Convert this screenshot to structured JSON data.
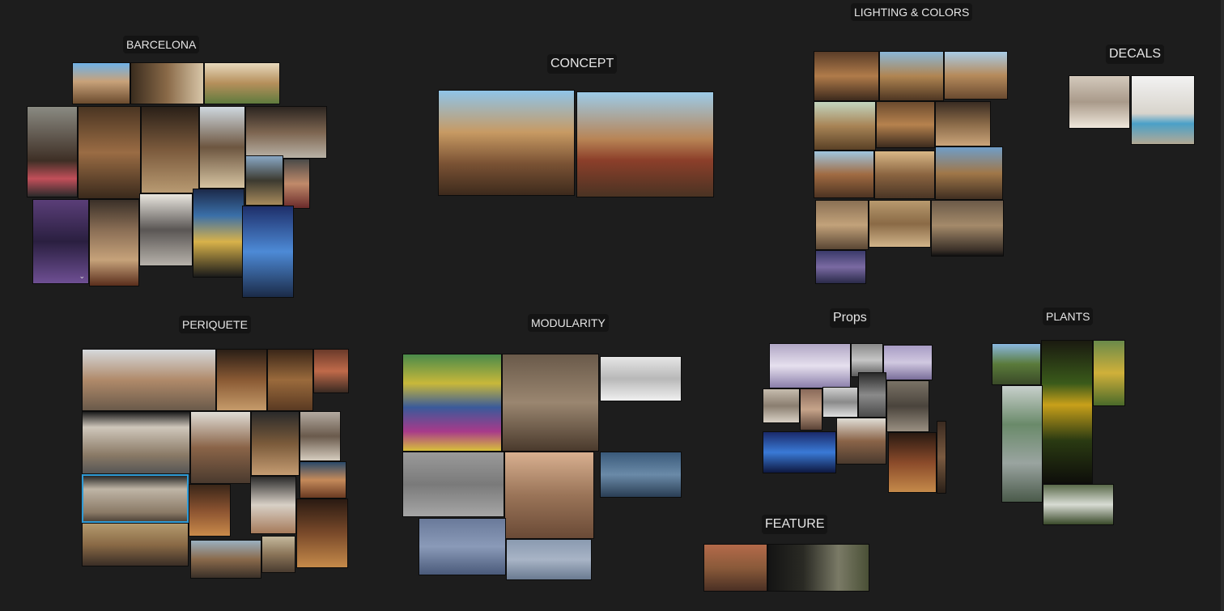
{
  "boards": {
    "barcelona": "BARCELONA",
    "concept": "CONCEPT",
    "lighting": "LIGHTING & COLORS",
    "decals": "DECALS",
    "periquete": "PERIQUETE",
    "modularity": "MODULARITY",
    "props": "Props",
    "plants": "PLANTS",
    "feature": "FEATURE"
  },
  "colors": {
    "background": "#1d1d1d",
    "label_bg": "#141414",
    "label_text": "#e6e6e6",
    "selection": "#2f9bd6"
  },
  "icons": {
    "video": "video-icon"
  }
}
